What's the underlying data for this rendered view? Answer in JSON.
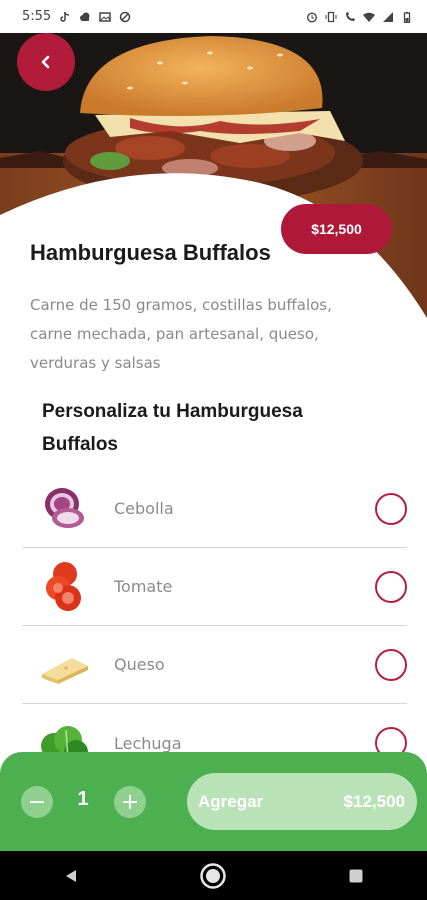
{
  "status_bar": {
    "time": "5:55",
    "left_icons": [
      "tiktok-icon",
      "cloud-icon",
      "gallery-icon",
      "data-saver-icon"
    ],
    "right_icons": [
      "alarm-icon",
      "vibrate-icon",
      "wifi-calling-icon",
      "wifi-icon",
      "signal-icon",
      "battery-icon"
    ]
  },
  "header": {
    "back_icon": "chevron-left-icon"
  },
  "product": {
    "price": "$12,500",
    "title": "Hamburguesa Buffalos",
    "description": "Carne de 150 gramos, costillas buffalos, carne mechada, pan artesanal, queso, verduras y salsas"
  },
  "customize": {
    "title": "Personaliza tu Hamburguesa Buffalos",
    "options": [
      {
        "label": "Cebolla",
        "icon": "onion-icon",
        "selected": false
      },
      {
        "label": "Tomate",
        "icon": "tomato-icon",
        "selected": false
      },
      {
        "label": "Queso",
        "icon": "cheese-icon",
        "selected": false
      },
      {
        "label": "Lechuga",
        "icon": "lettuce-icon",
        "selected": false
      }
    ]
  },
  "cart_bar": {
    "minus_label": "−",
    "quantity": "1",
    "plus_label": "+",
    "add_label": "Agregar",
    "add_price": "$12,500"
  },
  "colors": {
    "accent_red": "#b0183a",
    "cart_green": "#4caf50",
    "button_light_green": "#b9e3b6"
  },
  "nav_bar": {
    "items": [
      "back-triangle-icon",
      "home-circle-icon",
      "recents-square-icon"
    ]
  }
}
